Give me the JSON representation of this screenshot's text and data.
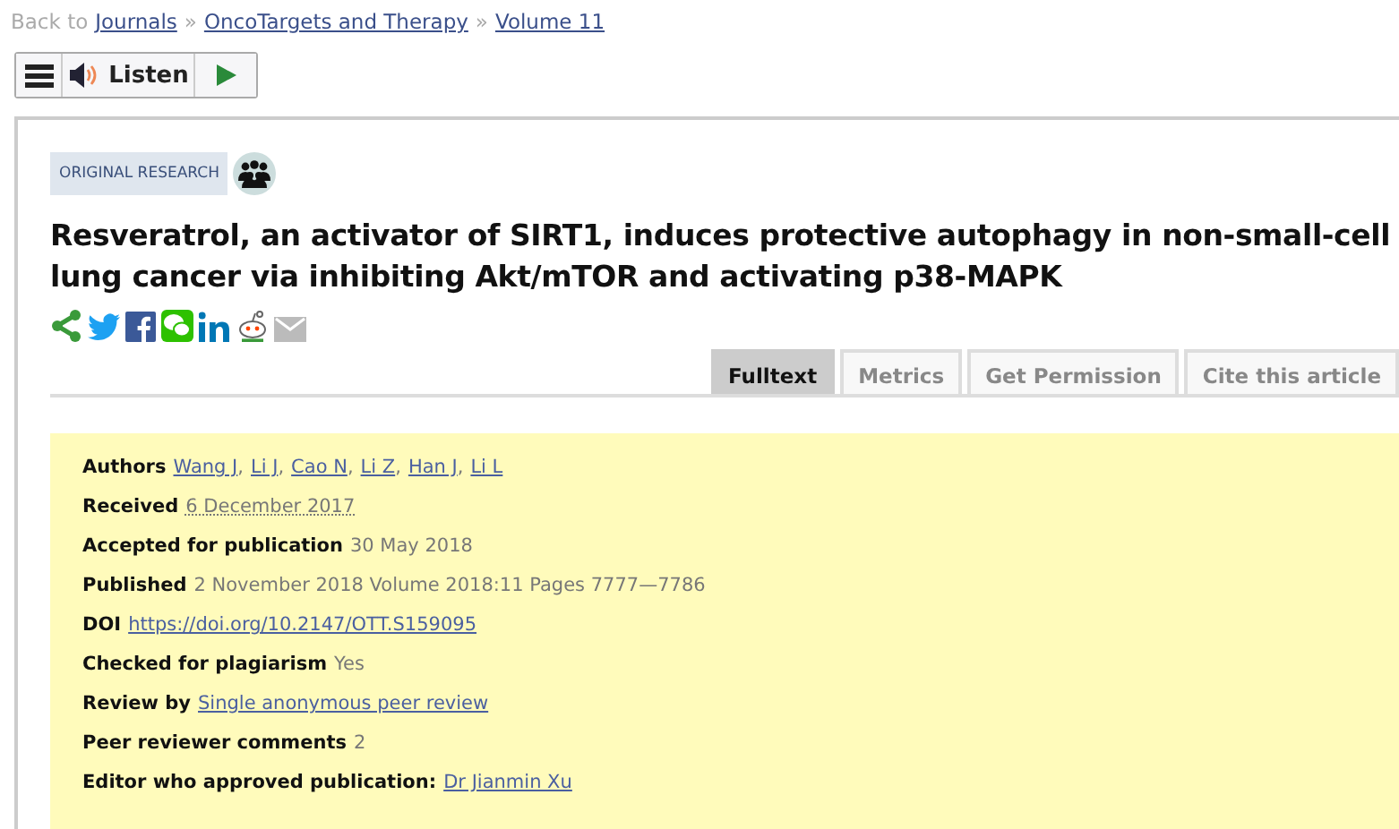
{
  "breadcrumb": {
    "prefix": "Back to",
    "links": [
      {
        "text": "Journals"
      },
      {
        "text": "OncoTargets and Therapy"
      },
      {
        "text": "Volume 11"
      }
    ],
    "separator": "»"
  },
  "toolbar": {
    "listen_label": "Listen"
  },
  "article": {
    "badge": "ORIGINAL RESEARCH",
    "title": "Resveratrol, an activator of SIRT1, induces protective autophagy in non-small-cell lung cancer via inhibiting Akt/mTOR and activating p38-MAPK",
    "share": [
      {
        "kind": "share"
      },
      {
        "kind": "twitter"
      },
      {
        "kind": "facebook"
      },
      {
        "kind": "wechat"
      },
      {
        "kind": "linkedin"
      },
      {
        "kind": "reddit"
      },
      {
        "kind": "email"
      }
    ],
    "tabs": [
      {
        "label": "Fulltext",
        "selected": true
      },
      {
        "label": "Metrics",
        "selected": false
      },
      {
        "label": "Get Permission",
        "selected": false
      },
      {
        "label": "Cite this article",
        "selected": false
      }
    ],
    "details": [
      {
        "label": "Authors",
        "parts": [
          {
            "kind": "link",
            "text": "Wang J"
          },
          {
            "kind": "plain",
            "text": ","
          },
          {
            "kind": "link",
            "text": "Li J"
          },
          {
            "kind": "plain",
            "text": ","
          },
          {
            "kind": "link",
            "text": "Cao N"
          },
          {
            "kind": "plain",
            "text": ","
          },
          {
            "kind": "link",
            "text": "Li Z"
          },
          {
            "kind": "plain",
            "text": ","
          },
          {
            "kind": "link",
            "text": "Han J"
          },
          {
            "kind": "plain",
            "text": ","
          },
          {
            "kind": "link",
            "text": "Li L"
          }
        ]
      },
      {
        "label": "Received",
        "parts": [
          {
            "kind": "date",
            "text": "6 December 2017"
          }
        ]
      },
      {
        "label": "Accepted for publication",
        "parts": [
          {
            "kind": "plain",
            "text": "30 May 2018"
          }
        ]
      },
      {
        "label": "Published",
        "parts": [
          {
            "kind": "plain",
            "text": "2 November 2018 Volume 2018:11 Pages 7777—7786"
          }
        ]
      },
      {
        "label": "DOI",
        "parts": [
          {
            "kind": "link",
            "text": "https://doi.org/10.2147/OTT.S159095"
          }
        ]
      },
      {
        "label": "Checked for plagiarism",
        "parts": [
          {
            "kind": "plain",
            "text": "Yes"
          }
        ]
      },
      {
        "label": "Review by",
        "parts": [
          {
            "kind": "link",
            "text": "Single anonymous peer review"
          }
        ]
      },
      {
        "label": "Peer reviewer comments",
        "parts": [
          {
            "kind": "plain",
            "text": "2"
          }
        ]
      },
      {
        "label": "Editor who approved publication:",
        "parts": [
          {
            "kind": "link",
            "text": "Dr Jianmin Xu"
          }
        ]
      }
    ]
  }
}
